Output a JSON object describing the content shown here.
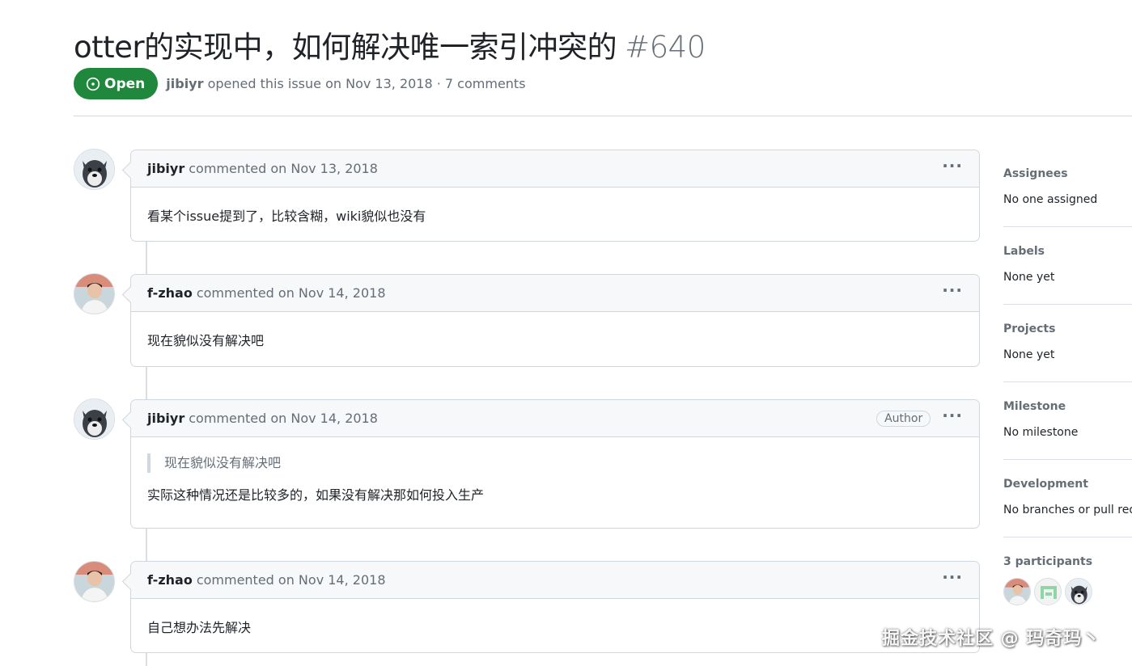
{
  "issue": {
    "title": "otter的实现中，如何解决唯一索引冲突的",
    "number": "#640",
    "state": "Open",
    "author": "jibiyr",
    "opened_text": "opened this issue on Nov 13, 2018 · 7 comments"
  },
  "comments": [
    {
      "user": "jibiyr",
      "action": "commented on Nov 13, 2018",
      "avatar": "schnauzer-dog-avatar",
      "author_badge": "",
      "quote": "",
      "body": "看某个issue提到了，比较含糊，wiki貌似也没有"
    },
    {
      "user": "f-zhao",
      "action": "commented on Nov 14, 2018",
      "avatar": "person-photo-avatar",
      "author_badge": "",
      "quote": "",
      "body": "现在貌似没有解决吧"
    },
    {
      "user": "jibiyr",
      "action": "commented on Nov 14, 2018",
      "avatar": "schnauzer-dog-avatar",
      "author_badge": "Author",
      "quote": "现在貌似没有解决吧",
      "body": "实际这种情况还是比较多的，如果没有解决那如何投入生产"
    },
    {
      "user": "f-zhao",
      "action": "commented on Nov 14, 2018",
      "avatar": "person-photo-avatar",
      "author_badge": "",
      "quote": "",
      "body": "自己想办法先解决"
    }
  ],
  "sidebar": {
    "assignees": {
      "heading": "Assignees",
      "value": "No one assigned"
    },
    "labels": {
      "heading": "Labels",
      "value": "None yet"
    },
    "projects": {
      "heading": "Projects",
      "value": "None yet"
    },
    "milestone": {
      "heading": "Milestone",
      "value": "No milestone"
    },
    "development": {
      "heading": "Development",
      "value": "No branches or pull requ"
    },
    "participants": {
      "heading": "3 participants"
    }
  },
  "watermark": "掘金技术社区 @ 玛奇玛丶",
  "colors": {
    "open_green": "#1f883d",
    "border": "#d0d7de",
    "muted": "#656d76"
  }
}
